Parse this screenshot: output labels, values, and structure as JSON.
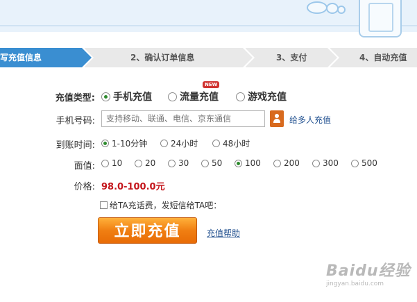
{
  "steps": [
    {
      "label": "写充值信息",
      "active": true
    },
    {
      "label": "2、确认订单信息",
      "active": false
    },
    {
      "label": "3、支付",
      "active": false
    },
    {
      "label": "4、自动充值",
      "active": false
    }
  ],
  "form": {
    "type_label": "充值类型:",
    "types": [
      {
        "label": "手机充值",
        "selected": true
      },
      {
        "label": "流量充值",
        "selected": false
      },
      {
        "label": "游戏充值",
        "selected": false
      }
    ],
    "new_badge": "NEW",
    "phone_label": "手机号码:",
    "phone_placeholder": "支持移动、联通、电信、京东通信",
    "phone_value": "",
    "multi_recharge_link": "给多人充值",
    "arrival_label": "到账时间:",
    "arrival_options": [
      {
        "label": "1-10分钟",
        "selected": true
      },
      {
        "label": "24小时",
        "selected": false
      },
      {
        "label": "48小时",
        "selected": false
      }
    ],
    "amount_label": "面值:",
    "amounts": [
      {
        "label": "10",
        "selected": false
      },
      {
        "label": "20",
        "selected": false
      },
      {
        "label": "30",
        "selected": false
      },
      {
        "label": "50",
        "selected": false
      },
      {
        "label": "100",
        "selected": true
      },
      {
        "label": "200",
        "selected": false
      },
      {
        "label": "300",
        "selected": false
      },
      {
        "label": "500",
        "selected": false
      }
    ],
    "price_label": "价格:",
    "price_value": "98.0-100.0元",
    "gift_checkbox_label": "给TA充话费，发短信给TA吧：",
    "gift_checked": false,
    "submit_label": "立即充值",
    "help_link": "充值帮助"
  },
  "watermark": {
    "logo": "Baidu经验",
    "url": "jingyan.baidu.com"
  },
  "colors": {
    "step_active": "#3a8ed1",
    "step_inactive": "#e9e9e9",
    "price": "#c4161c",
    "submit": "#f07f12",
    "link": "#1f4f8f"
  }
}
